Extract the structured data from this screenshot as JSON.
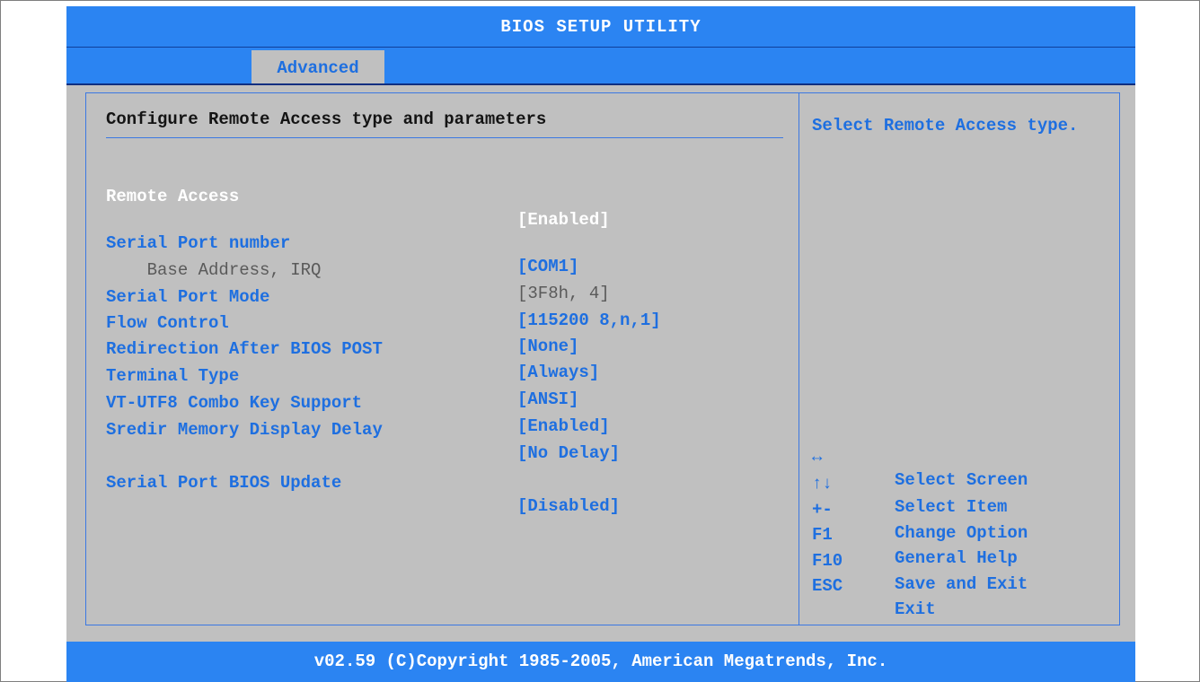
{
  "title": "BIOS SETUP UTILITY",
  "tabs": [
    {
      "label": "Advanced",
      "active": true
    }
  ],
  "section_heading": "Configure Remote Access type and parameters",
  "settings": [
    {
      "label": "Remote Access",
      "value": "[Enabled]",
      "state": "selected"
    },
    {
      "label": "Serial Port number",
      "value": "[COM1]",
      "state": "normal"
    },
    {
      "label": "    Base Address, IRQ",
      "value": "[3F8h, 4]",
      "state": "readonly"
    },
    {
      "label": "Serial Port Mode",
      "value": "[115200 8,n,1]",
      "state": "normal"
    },
    {
      "label": "Flow Control",
      "value": "[None]",
      "state": "normal"
    },
    {
      "label": "Redirection After BIOS POST",
      "value": "[Always]",
      "state": "normal"
    },
    {
      "label": "Terminal Type",
      "value": "[ANSI]",
      "state": "normal"
    },
    {
      "label": "VT-UTF8 Combo Key Support",
      "value": "[Enabled]",
      "state": "normal"
    },
    {
      "label": "Sredir Memory Display Delay",
      "value": "[No Delay]",
      "state": "normal"
    },
    {
      "label": "Serial Port BIOS Update",
      "value": "[Disabled]",
      "state": "normal"
    }
  ],
  "help_text": "Select Remote Access type.",
  "key_legend": [
    {
      "key": "↔",
      "action": "Select Screen"
    },
    {
      "key": "↑↓",
      "action": "Select Item"
    },
    {
      "key": "+-",
      "action": "Change Option"
    },
    {
      "key": "F1",
      "action": "General Help"
    },
    {
      "key": "F10",
      "action": "Save and Exit"
    },
    {
      "key": "ESC",
      "action": "Exit"
    }
  ],
  "footer": "v02.59 (C)Copyright 1985-2005, American Megatrends, Inc.",
  "colors": {
    "bar_blue": "#2b84f2",
    "body_gray": "#c0c0c0",
    "option_blue": "#1e6fe0",
    "selected_white": "#ffffff"
  }
}
